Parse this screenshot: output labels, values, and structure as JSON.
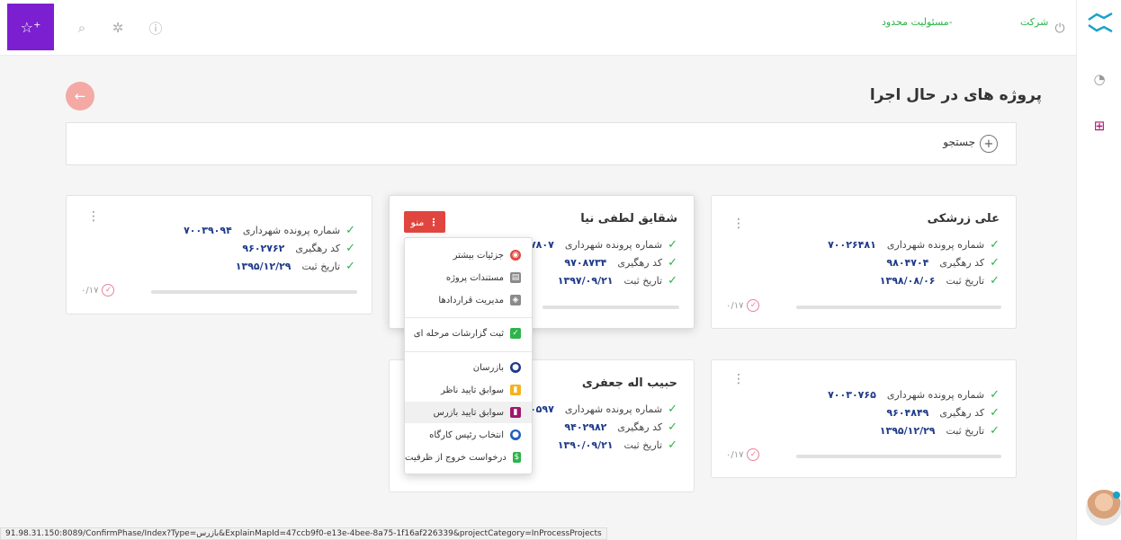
{
  "topbar": {
    "company_prefix": "شرکت",
    "company_name": "-مسئولیت محدود",
    "icons": [
      "user-add-icon",
      "search-icon",
      "settings-icon",
      "help-icon",
      "power-icon"
    ]
  },
  "sidebar": {
    "icons": [
      "handshake-logo-icon",
      "dashboard-icon",
      "briefcase-icon"
    ]
  },
  "page": {
    "title": "پروژه های در حال اجرا",
    "search_label": "جستجو"
  },
  "labels": {
    "file_no": "شماره پرونده شهرداری",
    "tracking": "کد رهگیری",
    "reg_date": "تاریخ ثبت",
    "menu": "منو"
  },
  "cards": [
    {
      "name": "علی زرشکی",
      "file_no": "۷۰۰۲۶۴۸۱",
      "tracking": "۹۸۰۴۷۰۴",
      "reg_date": "۱۳۹۸/۰۸/۰۶",
      "progress": "۰/۱۷"
    },
    {
      "name": "شقایق لطفی نیا",
      "file_no": "۷۸۰۷",
      "tracking": "۹۷۰۸۷۳۴",
      "reg_date": "۱۳۹۷/۰۹/۲۱",
      "progress": "۰/۱۷"
    },
    {
      "name": "",
      "file_no": "۷۰۰۳۹۰۹۴",
      "tracking": "۹۶۰۲۷۶۲",
      "reg_date": "۱۳۹۵/۱۲/۲۹",
      "progress": "۰/۱۷"
    },
    {
      "name": "",
      "file_no": "۷۰۰۳۰۷۶۵",
      "tracking": "۹۶۰۴۸۴۹",
      "reg_date": "۱۳۹۵/۱۲/۲۹",
      "progress": "۰/۱۷"
    },
    {
      "name": "حبیب اله جعفری",
      "file_no": "۰۵۹۷",
      "tracking": "۹۴۰۲۹۸۲",
      "reg_date": "۱۳۹۰/۰۹/۲۱",
      "progress": "۰/۱۷"
    }
  ],
  "dropdown": [
    {
      "label": "جزئیات بیشتر",
      "icon": "eye-icon",
      "color": "#e0463f"
    },
    {
      "label": "مستندات پروژه",
      "icon": "document-icon",
      "color": "#8a8a8a"
    },
    {
      "label": "مدیریت قراردادها",
      "icon": "layers-icon",
      "color": "#8a8a8a"
    },
    {
      "label": "ثبت گزارشات مرحله ای",
      "icon": "check-square-icon",
      "color": "#2db34a"
    },
    {
      "label": "بازرسان",
      "icon": "user-circle-icon",
      "color": "#1e3a8a"
    },
    {
      "label": "سوابق تایید ناظر",
      "icon": "folder-icon",
      "color": "#f4b21f"
    },
    {
      "label": "سوابق تایید بازرس",
      "icon": "bookmark-icon",
      "color": "#a0176b"
    },
    {
      "label": "انتخاب رئیس کارگاه",
      "icon": "person-icon",
      "color": "#1e5fb8"
    },
    {
      "label": "درخواست خروج از ظرفیت",
      "icon": "exit-bag-icon",
      "color": "#2db34a"
    }
  ],
  "status_url": "91.98.31.150:8089/ConfirmPhase/Index?Type=بازرس&ExplainMapId=47ccb9f0-e13e-4bee-8a75-1f16af226339&projectCategory=InProcessProjects"
}
